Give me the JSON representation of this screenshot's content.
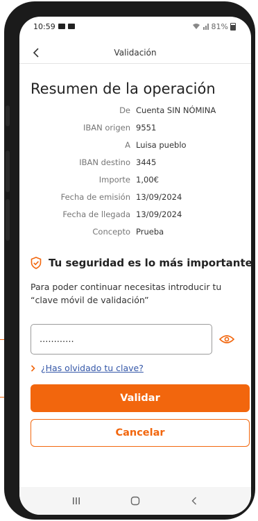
{
  "status_bar": {
    "time": "10:59",
    "battery": "81%"
  },
  "header": {
    "title": "Validación"
  },
  "page": {
    "title": "Resumen de la operación"
  },
  "summary": {
    "rows": [
      {
        "label": "De",
        "value": "Cuenta SIN NÓMINA"
      },
      {
        "label": "IBAN origen",
        "value": "9551"
      },
      {
        "label": "A",
        "value": "Luisa pueblo"
      },
      {
        "label": "IBAN destino",
        "value": "3445"
      },
      {
        "label": "Importe",
        "value": "1,00€"
      },
      {
        "label": "Fecha de emisión",
        "value": "13/09/2024"
      },
      {
        "label": "Fecha de llegada",
        "value": "13/09/2024"
      },
      {
        "label": "Concepto",
        "value": "Prueba"
      }
    ]
  },
  "security": {
    "title": "Tu seguridad es lo más importante",
    "text": "Para poder continuar necesitas introducir tu “clave móvil de validación”",
    "icon": "shield-check-icon"
  },
  "password": {
    "value": "............"
  },
  "forgot": {
    "label": "¿Has olvidado tu clave?"
  },
  "actions": {
    "validate_label": "Validar",
    "cancel_label": "Cancelar"
  },
  "colors": {
    "accent": "#f2660d",
    "link": "#3457a8"
  }
}
